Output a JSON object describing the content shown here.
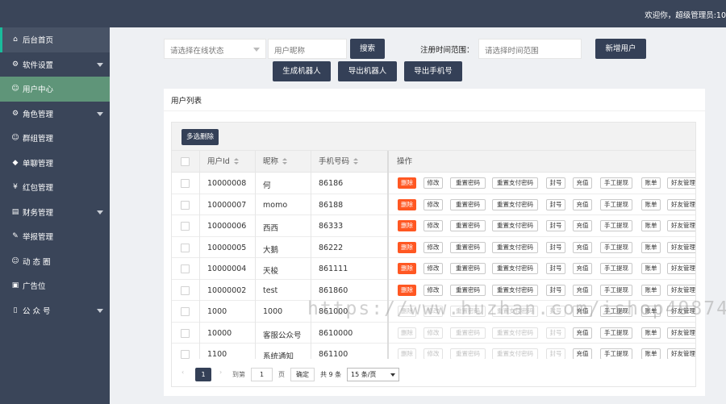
{
  "header": {
    "welcome": "欢迎你，超级管理员:10"
  },
  "sidebar": {
    "items": [
      {
        "label": "后台首页",
        "icon": "home-icon",
        "has_arrow": false,
        "state": "home"
      },
      {
        "label": "软件设置",
        "icon": "gear-icon",
        "has_arrow": true,
        "state": ""
      },
      {
        "label": "用户中心",
        "icon": "user-icon",
        "has_arrow": false,
        "state": "active"
      },
      {
        "label": "角色管理",
        "icon": "gear-icon",
        "has_arrow": true,
        "state": ""
      },
      {
        "label": "群组管理",
        "icon": "group-icon",
        "has_arrow": false,
        "state": ""
      },
      {
        "label": "单聊管理",
        "icon": "tag-icon",
        "has_arrow": false,
        "state": ""
      },
      {
        "label": "红包管理",
        "icon": "yen-icon",
        "has_arrow": false,
        "state": ""
      },
      {
        "label": "财务管理",
        "icon": "calendar-icon",
        "has_arrow": true,
        "state": ""
      },
      {
        "label": "举报管理",
        "icon": "edit-icon",
        "has_arrow": false,
        "state": ""
      },
      {
        "label": "动 态 圈",
        "icon": "smile-icon",
        "has_arrow": false,
        "state": ""
      },
      {
        "label": "广告位",
        "icon": "picture-icon",
        "has_arrow": false,
        "state": ""
      },
      {
        "label": "公 众 号",
        "icon": "cellphone-icon",
        "has_arrow": true,
        "state": ""
      }
    ]
  },
  "filters": {
    "status_placeholder": "请选择在线状态",
    "nickname_placeholder": "用户昵称",
    "search_label": "搜索",
    "date_range_label": "注册时间范围：",
    "date_range_placeholder": "请选择时间范围",
    "add_user_label": "新增用户",
    "gen_robot_label": "生成机器人",
    "export_robot_label": "导出机器人",
    "export_phone_label": "导出手机号"
  },
  "panel": {
    "title": "用户列表",
    "bulk_delete_label": "多选删除"
  },
  "table": {
    "columns": {
      "id": "用户Id",
      "nickname": "昵称",
      "phone": "手机号码",
      "actions": "操作"
    },
    "rows": [
      {
        "id": "10000008",
        "nickname": "何",
        "phone": "86186",
        "disabled": false
      },
      {
        "id": "10000007",
        "nickname": "momo",
        "phone": "86188",
        "disabled": false
      },
      {
        "id": "10000006",
        "nickname": "西西",
        "phone": "86333",
        "disabled": false
      },
      {
        "id": "10000005",
        "nickname": "大鹅",
        "phone": "86222",
        "disabled": false
      },
      {
        "id": "10000004",
        "nickname": "天梭",
        "phone": "861111",
        "disabled": false
      },
      {
        "id": "10000002",
        "nickname": "test",
        "phone": "861860",
        "disabled": false
      },
      {
        "id": "1000",
        "nickname": "1000",
        "phone": "861000",
        "disabled": true
      },
      {
        "id": "10000",
        "nickname": "客服公众号",
        "phone": "8610000",
        "disabled": true
      },
      {
        "id": "1100",
        "nickname": "系统通知",
        "phone": "861100",
        "disabled": true
      }
    ],
    "actions": [
      "删除",
      "修改",
      "重置密码",
      "重置支付密码",
      "封号",
      "充值",
      "手工提现",
      "账单",
      "好友管理"
    ]
  },
  "pagination": {
    "current_page": "1",
    "goto_label": "到第",
    "page_input": "1",
    "page_unit": "页",
    "confirm_label": "确定",
    "total_label": "共 9 条",
    "page_size": "15 条/页"
  },
  "watermark": "https://www.huzhan.com/ishop49874"
}
